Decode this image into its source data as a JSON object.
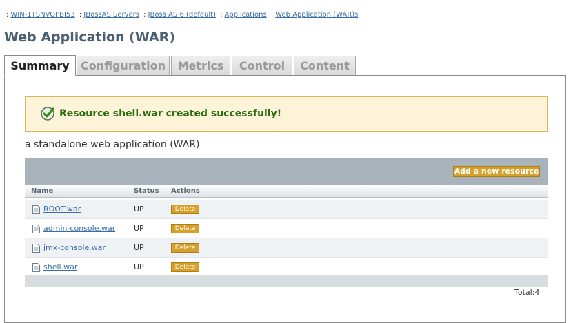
{
  "breadcrumb": {
    "items": [
      "WIN-1TSNVOPBI53",
      "JBossAS Servers",
      "JBoss AS 6 (default)",
      "Applications",
      "Web Application (WAR)s"
    ],
    "separator": ":"
  },
  "page": {
    "title": "Web Application (WAR)"
  },
  "tabs": [
    {
      "label": "Summary",
      "active": true
    },
    {
      "label": "Configuration",
      "active": false
    },
    {
      "label": "Metrics",
      "active": false
    },
    {
      "label": "Control",
      "active": false
    },
    {
      "label": "Content",
      "active": false
    }
  ],
  "message": {
    "text": "Resource shell.war created successfully!",
    "icon": "check-icon"
  },
  "description": "a standalone web application (WAR)",
  "toolbar": {
    "add_label": "Add a new resource"
  },
  "table": {
    "columns": [
      "Name",
      "Status",
      "Actions"
    ],
    "rows": [
      {
        "name": "ROOT.war",
        "status": "UP",
        "action": "Delete"
      },
      {
        "name": "admin-console.war",
        "status": "UP",
        "action": "Delete"
      },
      {
        "name": "jmx-console.war",
        "status": "UP",
        "action": "Delete"
      },
      {
        "name": "shell.war",
        "status": "UP",
        "action": "Delete"
      }
    ],
    "total_label": "Total:4"
  },
  "colors": {
    "link": "#3a6ea5",
    "title": "#4a5f73",
    "message_bg": "#fcf3d8",
    "message_text": "#2a6e12",
    "button": "#d6a02a",
    "toolbar": "#a8b3bb"
  }
}
